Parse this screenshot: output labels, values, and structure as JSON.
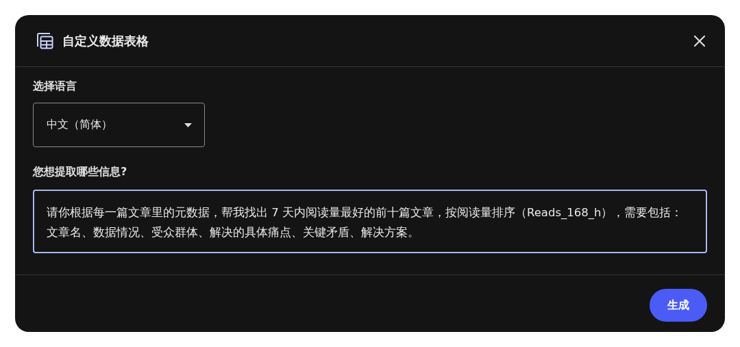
{
  "dialog": {
    "title": "自定义数据表格"
  },
  "language": {
    "label": "选择语言",
    "value": "中文（简体）"
  },
  "question": {
    "label": "您想提取哪些信息?",
    "value": "请你根据每一篇文章里的元数据，帮我找出 7 天内阅读量最好的前十篇文章，按阅读量排序（Reads_168_h），需要包括：文章名、数据情况、受众群体、解决的具体痛点、关键矛盾、解决方案。"
  },
  "buttons": [
    {
      "label": "生成",
      "kind": "primary"
    }
  ]
}
